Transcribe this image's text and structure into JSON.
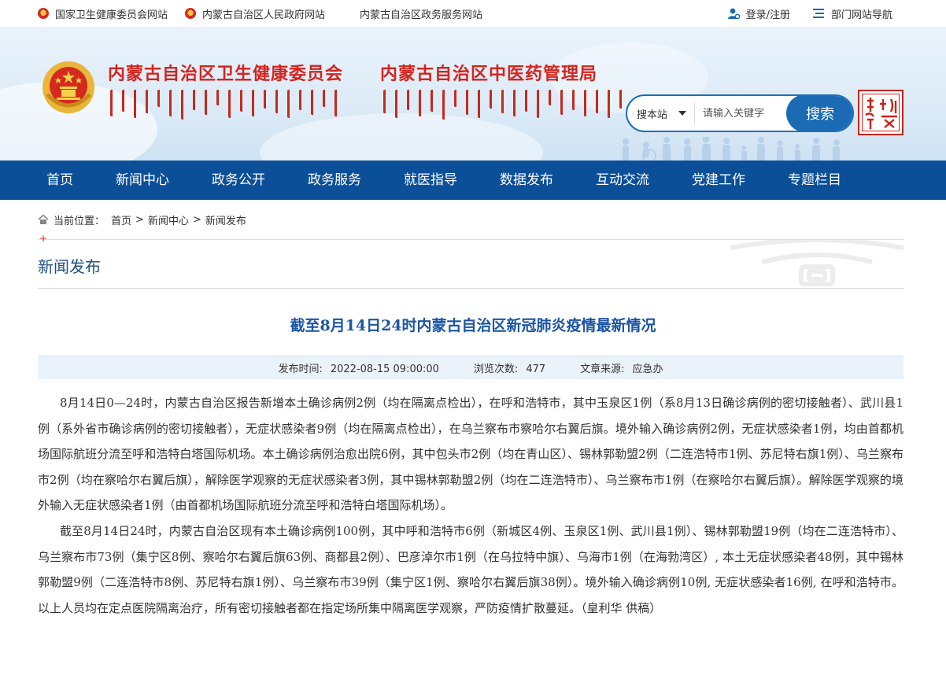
{
  "topbar": {
    "links": [
      {
        "label": "国家卫生健康委员会网站",
        "icon": "emblem-icon"
      },
      {
        "label": "内蒙古自治区人民政府网站",
        "icon": "emblem-icon"
      },
      {
        "label": "内蒙古自治区政务服务网站",
        "icon": ""
      }
    ],
    "login": "登录/注册",
    "dept_nav": "部门网站导航"
  },
  "header": {
    "title_left": "内蒙古自治区卫生健康委员会",
    "title_right": "内蒙古自治区中医药管理局",
    "search_scope": "搜本站",
    "search_placeholder": "请输入关键字",
    "search_button": "搜索"
  },
  "nav": [
    "首页",
    "新闻中心",
    "政务公开",
    "政务服务",
    "就医指导",
    "数据发布",
    "互动交流",
    "党建工作",
    "专题栏目"
  ],
  "breadcrumb": {
    "label": "当前位置：",
    "items": [
      "首页",
      "新闻中心",
      "新闻发布"
    ],
    "separator": ">"
  },
  "section_title": "新闻发布",
  "article": {
    "title": "截至8月14日24时内蒙古自治区新冠肺炎疫情最新情况",
    "meta": {
      "published_label": "发布时间:",
      "published": "2022-08-15 09:00:00",
      "views_label": "浏览次数:",
      "views": "477",
      "source_label": "文章来源:",
      "source": "应急办"
    },
    "paragraphs": [
      "8月14日0—24时，内蒙古自治区报告新增本土确诊病例2例（均在隔离点检出），在呼和浩特市，其中玉泉区1例（系8月13日确诊病例的密切接触者）、武川县1例（系外省市确诊病例的密切接触者），无症状感染者9例（均在隔离点检出），在乌兰察布市察哈尔右翼后旗。境外输入确诊病例2例，无症状感染者1例，均由首都机场国际航班分流至呼和浩特白塔国际机场。本土确诊病例治愈出院6例，其中包头市2例（均在青山区）、锡林郭勒盟2例（二连浩特市1例、苏尼特右旗1例）、乌兰察布市2例（均在察哈尔右翼后旗），解除医学观察的无症状感染者3例，其中锡林郭勒盟2例（均在二连浩特市）、乌兰察布市1例（在察哈尔右翼后旗）。解除医学观察的境外输入无症状感染者1例（由首都机场国际航班分流至呼和浩特白塔国际机场）。",
      "截至8月14日24时，内蒙古自治区现有本土确诊病例100例，其中呼和浩特市6例（新城区4例、玉泉区1例、武川县1例）、锡林郭勒盟19例（均在二连浩特市）、乌兰察布市73例（集宁区8例、察哈尔右翼后旗63例、商都县2例）、巴彦淖尔市1例（在乌拉特中旗）、乌海市1例（在海勃湾区）, 本土无症状感染者48例，其中锡林郭勒盟9例（二连浩特市8例、苏尼特右旗1例）、乌兰察布市39例（集宁区1例、察哈尔右翼后旗38例）。境外输入确诊病例10例, 无症状感染者16例, 在呼和浩特市。以上人员均在定点医院隔离治疗，所有密切接触者都在指定场所集中隔离医学观察，严防疫情扩散蔓延。（皇利华  供稿）"
    ]
  },
  "colors": {
    "nav_bg": "#0b4f99",
    "title_red": "#d5231d",
    "link_blue": "#1c55a4",
    "meta_bg": "#eaf2fa"
  }
}
